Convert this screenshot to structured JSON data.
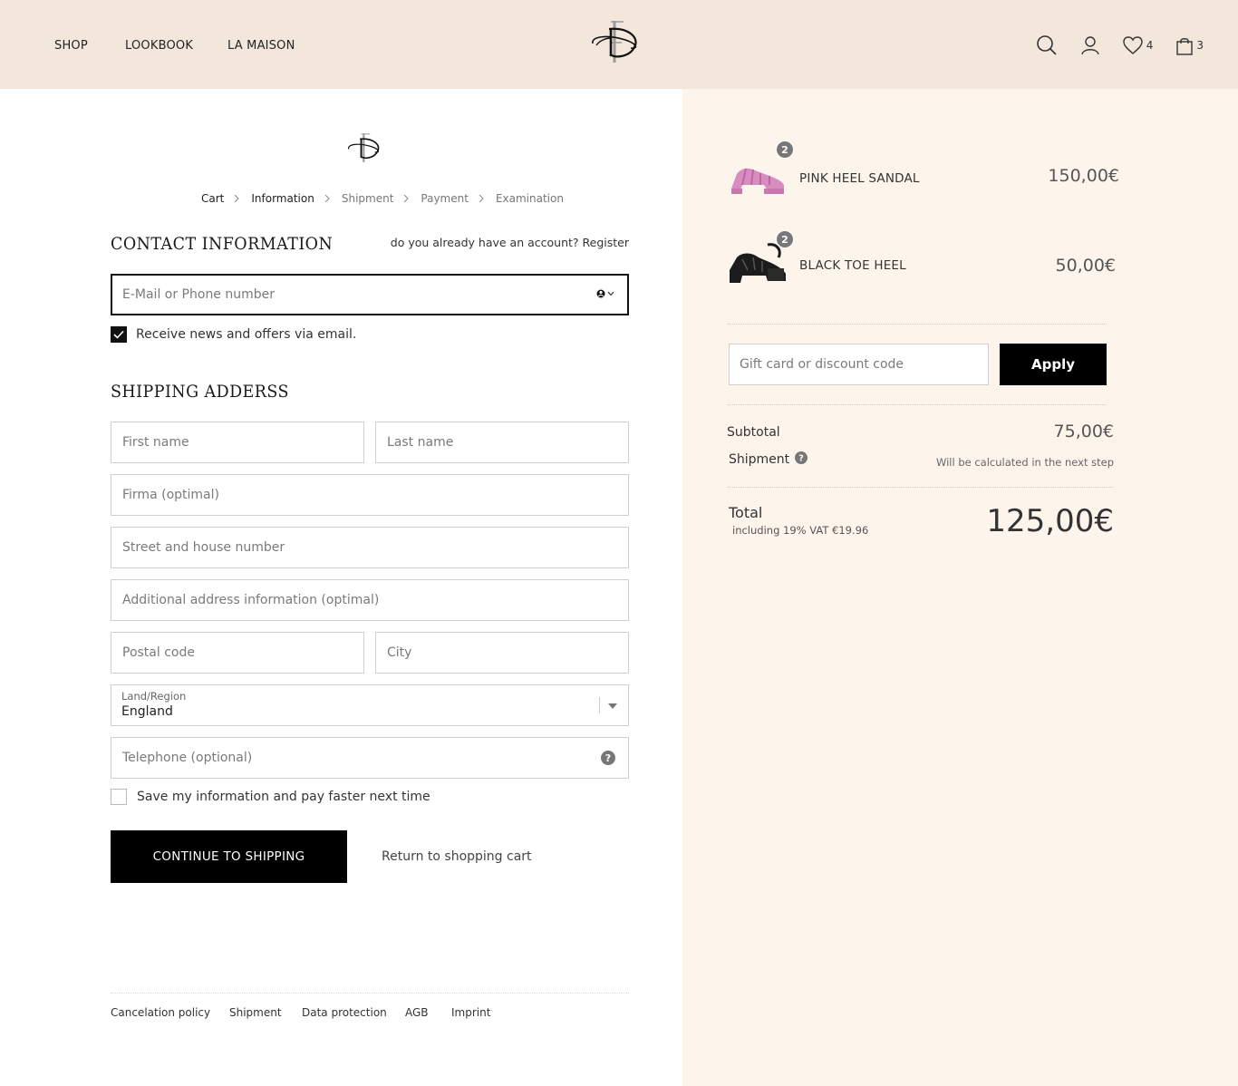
{
  "header": {
    "nav": [
      {
        "label": "SHOP"
      },
      {
        "label": "LOOKBOOK"
      },
      {
        "label": "LA MAISON"
      }
    ],
    "wishlist_count": "4",
    "cart_count": "3"
  },
  "breadcrumbs": [
    "Cart",
    "Information",
    "Shipment",
    "Payment",
    "Examination"
  ],
  "contact": {
    "title": "CONTACT INFORMATION",
    "account_prompt": "do you already have an account? Register",
    "email_placeholder": "E-Mail or Phone number",
    "newsletter_label": "Receive news and offers via email."
  },
  "shipping": {
    "title": "SHIPPING ADDERSS",
    "first_name": "First name",
    "last_name": "Last name",
    "firma": "Firma (optimal)",
    "street": "Street and house number",
    "additional": "Additional address information (optimal)",
    "postal": "Postal code",
    "city": "City",
    "land_label": "Land/Region",
    "land_value": "England",
    "telephone": "Telephone (optional)",
    "save_label": "Save my information and pay faster next time"
  },
  "actions": {
    "continue_label": "CONTINUE TO SHIPPING",
    "return_label": "Return to shopping cart"
  },
  "footer": [
    "Cancelation policy",
    "Shipment",
    "Data protection",
    "AGB",
    "Imprint"
  ],
  "summary": {
    "items": [
      {
        "name": "PINK HEEL SANDAL",
        "price": "150,00€",
        "qty": "2",
        "color": "#d98cc0"
      },
      {
        "name": "BLACK TOE HEEL",
        "price": "50,00€",
        "qty": "2",
        "color": "#1c1c1c"
      }
    ],
    "gift_placeholder": "Gift card or discount code",
    "apply_label": "Apply",
    "subtotal_label": "Subtotal",
    "subtotal_value": "75,00€",
    "shipment_label": "Shipment",
    "shipment_value": "Will be calculated in the next step",
    "total_label": "Total",
    "total_vat": "including 19% VAT €19.96",
    "total_value": "125,00€"
  },
  "colors": {
    "header_bg": "#f3e7dc",
    "summary_bg": "#fdf5ec",
    "button_bg": "#000000"
  }
}
